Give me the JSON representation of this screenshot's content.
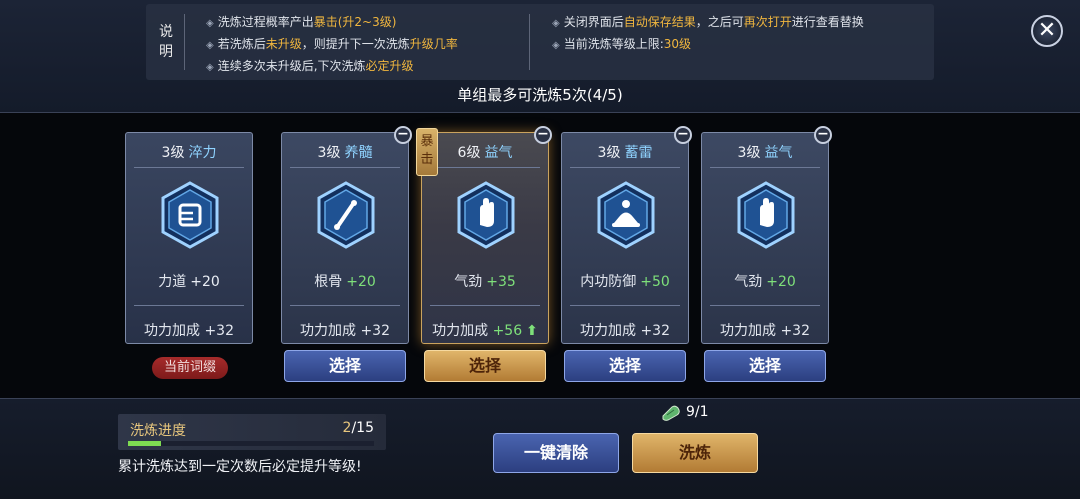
{
  "info": {
    "heading": "说明",
    "bullets_left": [
      {
        "pre": "洗炼过程概率产出",
        "hl": "暴击(升2~3级)",
        "post": ""
      },
      {
        "pre": "若洗炼后",
        "hl": "未升级",
        "post": "，则提升下一次洗炼",
        "hl2": "升级几率"
      },
      {
        "pre": "连续多次未升级后,下次洗炼",
        "hl": "必定升级",
        "post": ""
      }
    ],
    "bullets_right": [
      {
        "pre": "关闭界面后",
        "hl": "自动保存结果",
        "post": "，之后可",
        "hl2": "再次打开",
        "post2": "进行查看替换"
      },
      {
        "pre": "当前洗炼等级上限:",
        "hl": "30级",
        "post": ""
      }
    ]
  },
  "wash_limit": "单组最多可洗炼5次(4/5)",
  "cards": [
    {
      "level": "3级",
      "name": "淬力",
      "icon": "fist-icon",
      "stat_label": "力道",
      "stat_value": "+20",
      "stat_green": false,
      "bonus_label": "功力加成",
      "bonus_value": "+32",
      "bonus_green": false,
      "arrow": false
    },
    {
      "level": "3级",
      "name": "养髓",
      "icon": "bone-icon",
      "stat_label": "根骨",
      "stat_value": "+20",
      "stat_green": true,
      "bonus_label": "功力加成",
      "bonus_value": "+32",
      "bonus_green": false,
      "arrow": false
    },
    {
      "level": "6级",
      "name": "益气",
      "icon": "palm-icon",
      "stat_label": "气劲",
      "stat_value": "+35",
      "stat_green": true,
      "bonus_label": "功力加成",
      "bonus_value": "+56",
      "bonus_green": true,
      "arrow": true
    },
    {
      "level": "3级",
      "name": "蓄雷",
      "icon": "meditation-icon",
      "stat_label": "内功防御",
      "stat_value": "+50",
      "stat_green": true,
      "bonus_label": "功力加成",
      "bonus_value": "+32",
      "bonus_green": false,
      "arrow": false
    },
    {
      "level": "3级",
      "name": "益气",
      "icon": "palm-icon",
      "stat_label": "气劲",
      "stat_value": "+20",
      "stat_green": true,
      "bonus_label": "功力加成",
      "bonus_value": "+32",
      "bonus_green": false,
      "arrow": false
    }
  ],
  "crit_tag": "暴击",
  "current_badge": "当前词缀",
  "select_label": "选择",
  "minus_label": "−",
  "close_label": "✕",
  "progress": {
    "label": "洗炼进度",
    "current": "2",
    "total": "/15",
    "fraction": 0.1333
  },
  "hint": "累计洗炼达到一定次数后必定提升等级!",
  "material": {
    "icon": "jade-icon",
    "count": "9/1"
  },
  "buttons": {
    "clear": "一键清除",
    "wash": "洗炼"
  },
  "colors": {
    "accent_gold": "#f0b63f",
    "green": "#7ee07a",
    "level_blue": "#8fd3ff"
  }
}
